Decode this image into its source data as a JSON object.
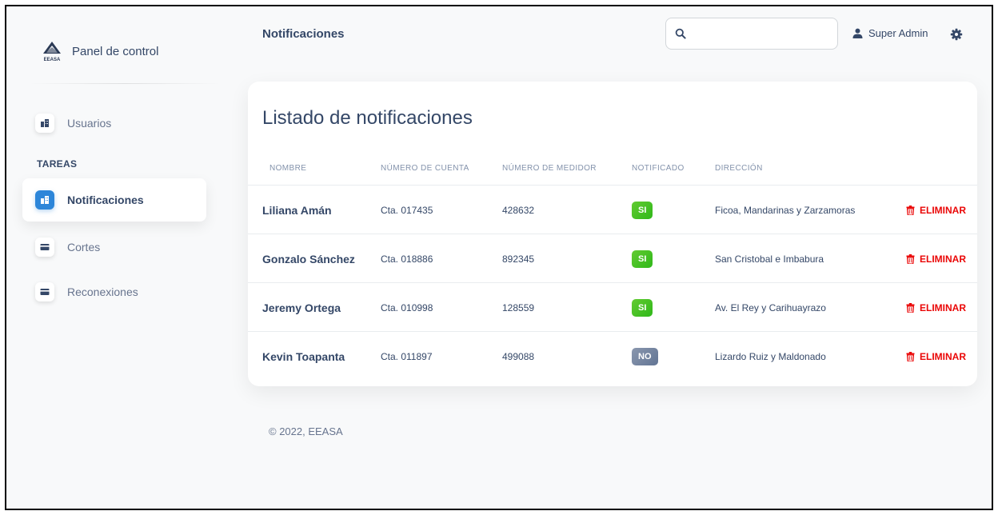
{
  "brand": {
    "name": "Panel de control",
    "logo_text": "EEASA"
  },
  "sidebar": {
    "items": [
      {
        "label": "Usuarios",
        "icon": "building-icon"
      }
    ],
    "section": "TAREAS",
    "task_items": [
      {
        "label": "Notificaciones",
        "icon": "building-icon",
        "active": true
      },
      {
        "label": "Cortes",
        "icon": "card-icon"
      },
      {
        "label": "Reconexiones",
        "icon": "card-icon"
      }
    ]
  },
  "header": {
    "title": "Notificaciones",
    "search": {
      "value": "",
      "placeholder": ""
    },
    "user": "Super Admin"
  },
  "table": {
    "title": "Listado de notificaciones",
    "columns": [
      "NOMBRE",
      "NÚMERO DE CUENTA",
      "NÚMERO DE MEDIDOR",
      "NOTIFICADO",
      "DIRECCIÓN"
    ],
    "rows": [
      {
        "name": "Liliana Amán",
        "account": "Cta. 017435",
        "meter": "428632",
        "notified": "SI",
        "address": "Ficoa, Mandarinas y Zarzamoras",
        "action": "ELIMINAR"
      },
      {
        "name": "Gonzalo Sánchez",
        "account": "Cta. 018886",
        "meter": "892345",
        "notified": "SI",
        "address": "San Cristobal e Imbabura",
        "action": "ELIMINAR"
      },
      {
        "name": "Jeremy Ortega",
        "account": "Cta. 010998",
        "meter": "128559",
        "notified": "SI",
        "address": "Av. El Rey y Carihuayrazo",
        "action": "ELIMINAR"
      },
      {
        "name": "Kevin Toapanta",
        "account": "Cta. 011897",
        "meter": "499088",
        "notified": "NO",
        "address": "Lizardo Ruiz y Maldonado",
        "action": "ELIMINAR"
      }
    ]
  },
  "footer": {
    "text": "© 2022, EEASA"
  },
  "colors": {
    "accent": "#2d86d9",
    "badge_yes": "#3dbb22",
    "badge_no": "#7283a0",
    "danger": "#ea0606",
    "text": "#344767"
  }
}
